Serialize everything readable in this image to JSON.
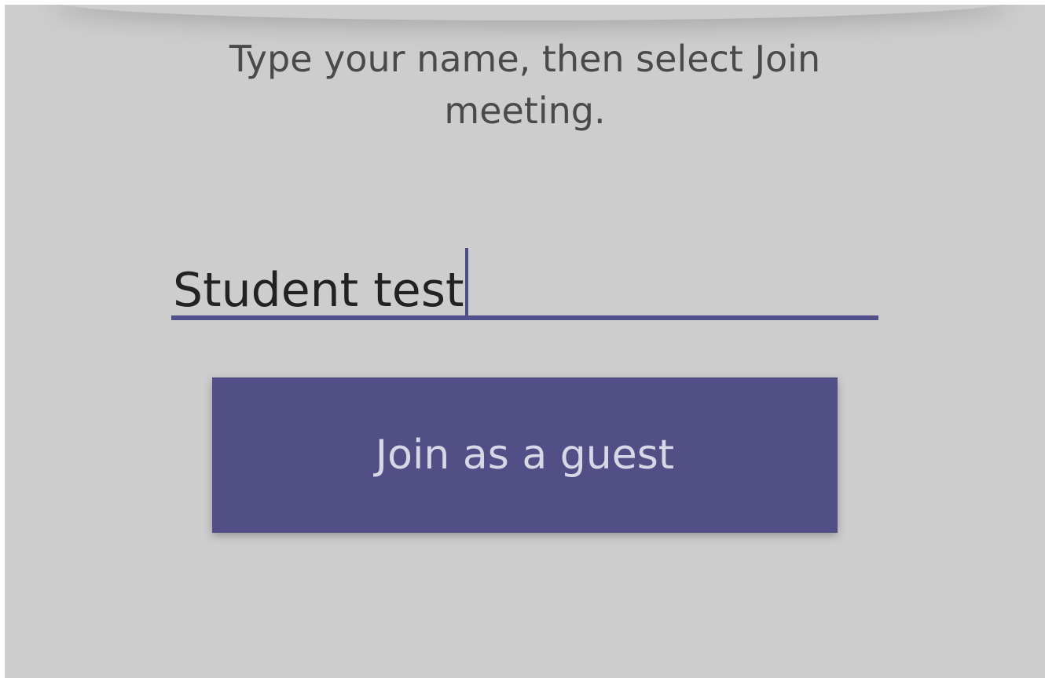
{
  "instruction": {
    "line1": "Type your name, then select Join",
    "line2": "meeting."
  },
  "name_input": {
    "value": "Student test"
  },
  "join_button": {
    "label": "Join as a guest"
  },
  "colors": {
    "accent": "#51508a",
    "background": "#cdcdcd",
    "button_text": "#d7d7e6"
  }
}
